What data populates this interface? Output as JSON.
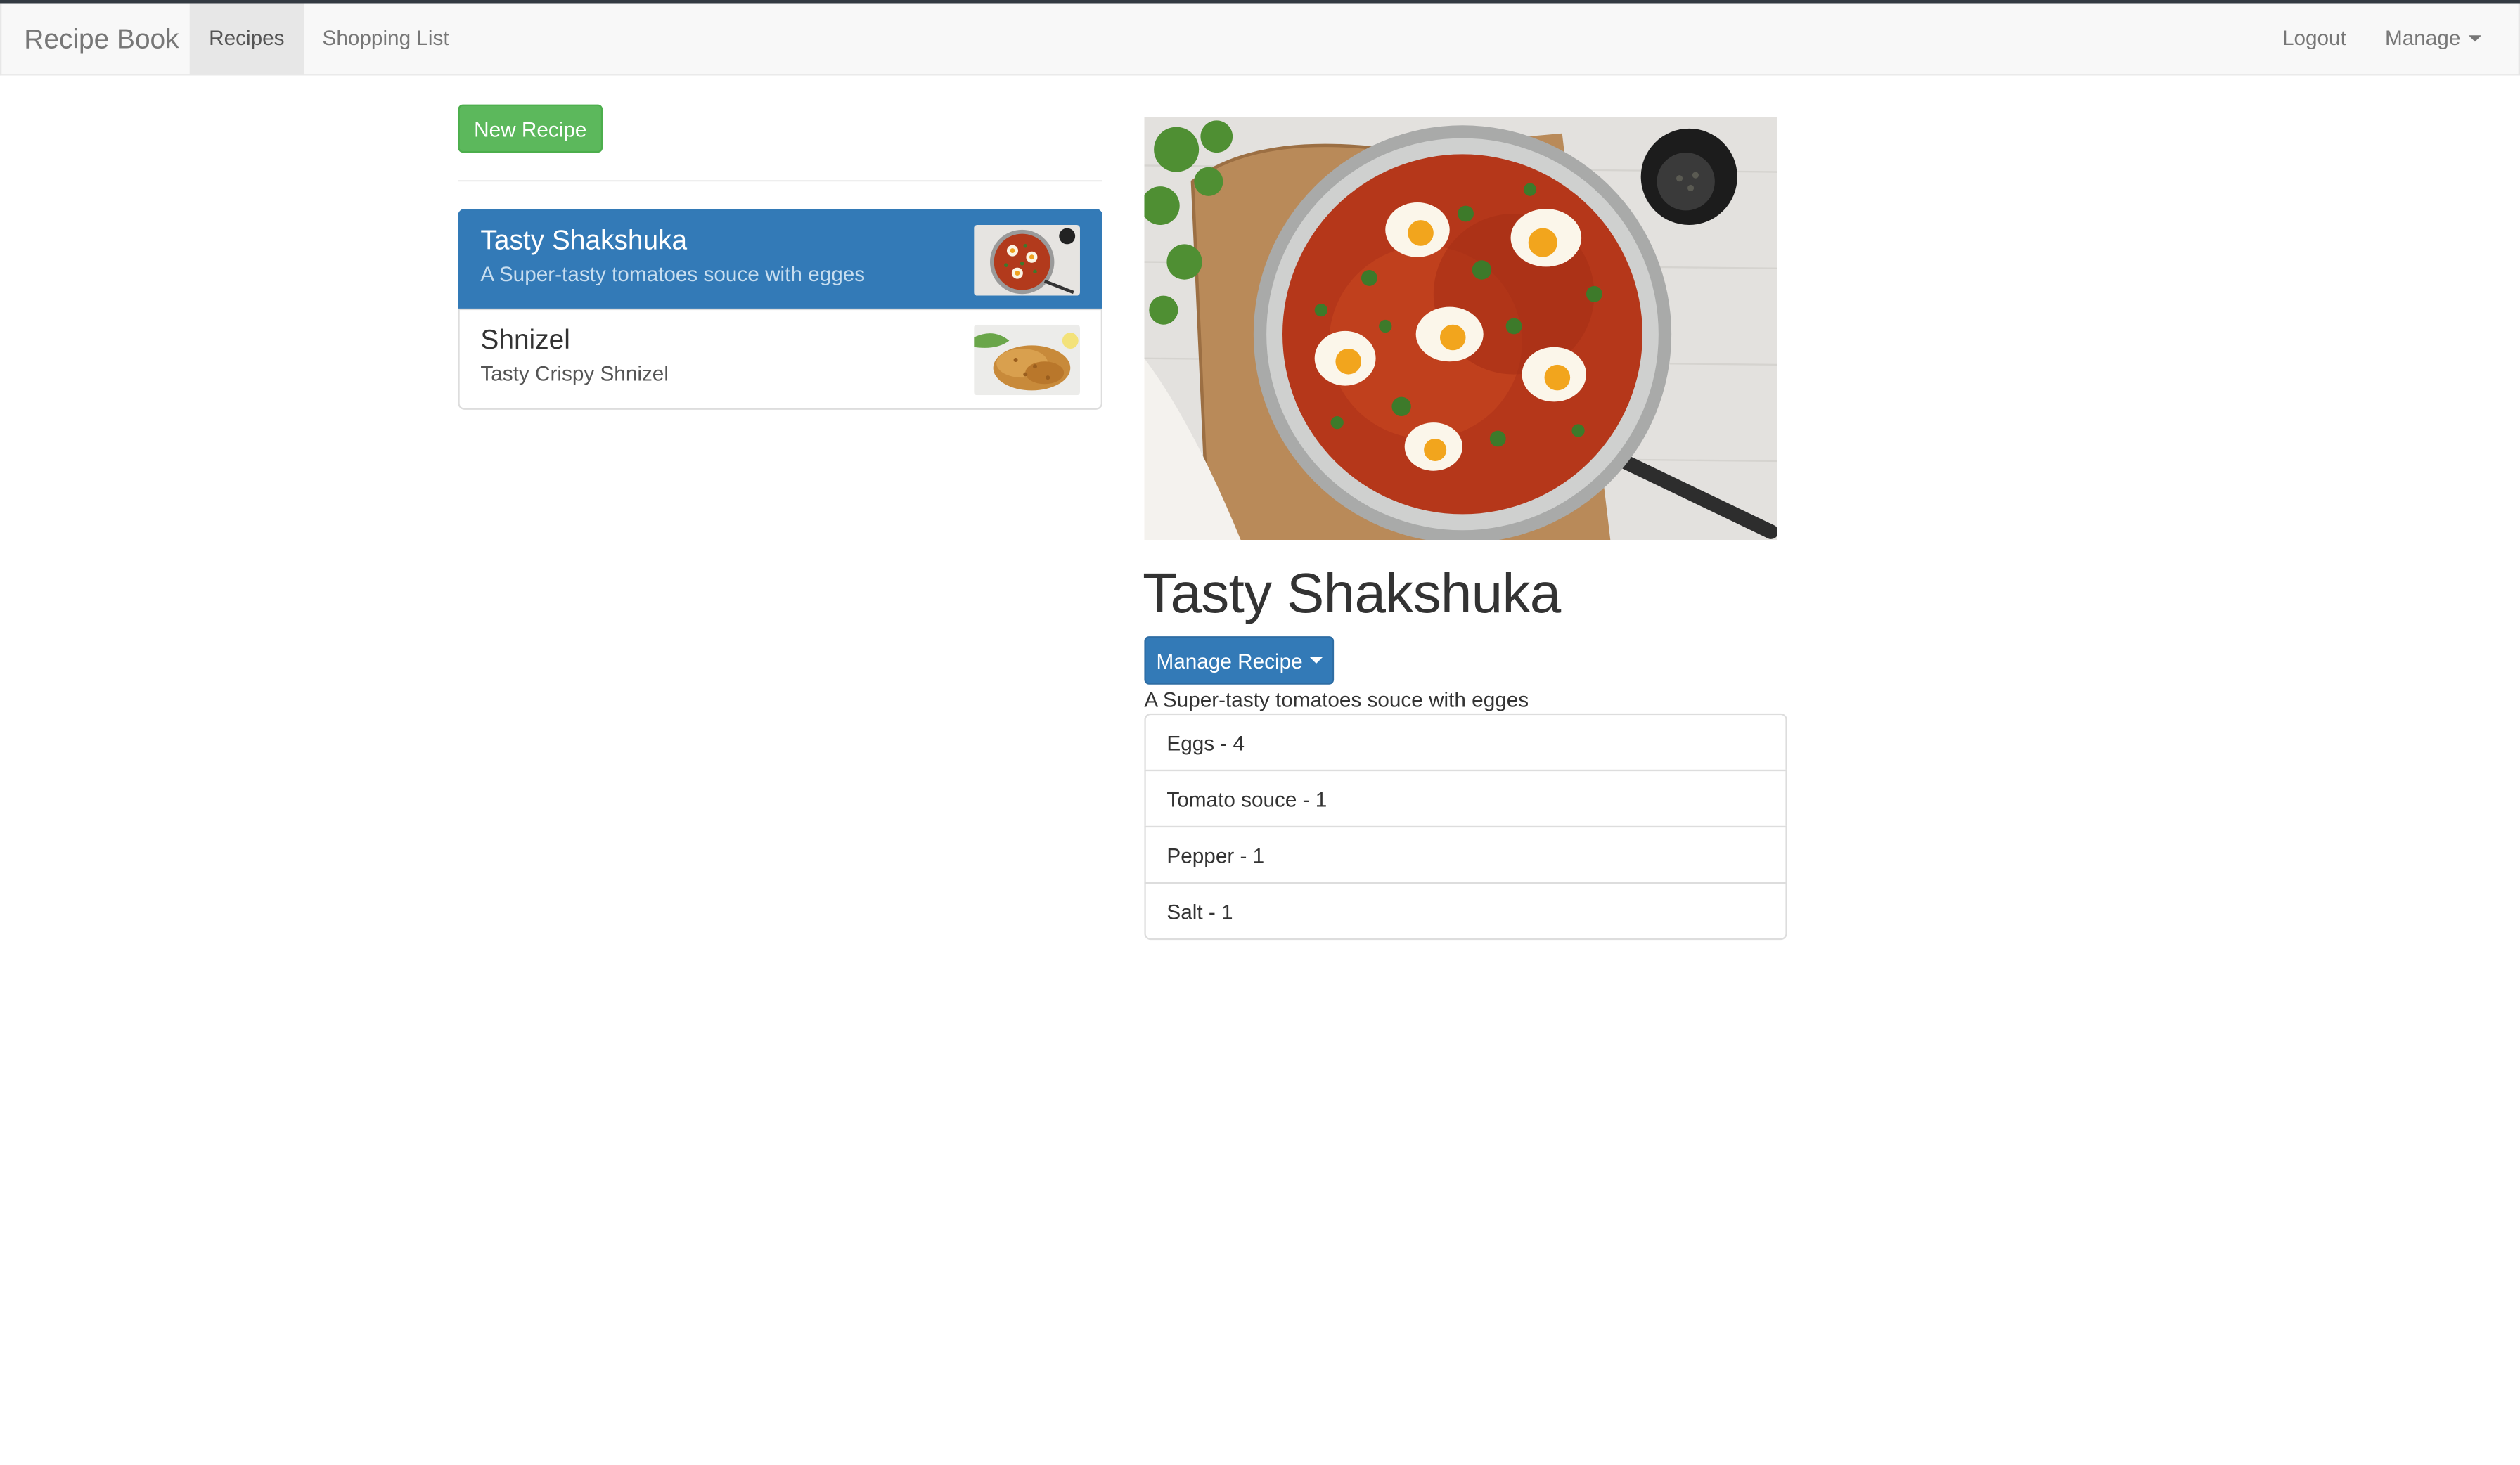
{
  "navbar": {
    "brand": "Recipe Book",
    "items": [
      {
        "label": "Recipes",
        "active": true
      },
      {
        "label": "Shopping List",
        "active": false
      }
    ],
    "logout": "Logout",
    "manage": "Manage"
  },
  "new_recipe_button": "New Recipe",
  "recipes": [
    {
      "name": "Tasty Shakshuka",
      "description": "A Super-tasty tomatoes souce with egges",
      "active": true
    },
    {
      "name": "Shnizel",
      "description": "Tasty Crispy Shnizel",
      "active": false
    }
  ],
  "detail": {
    "title": "Tasty Shakshuka",
    "manage_button": "Manage Recipe",
    "description": "A Super-tasty tomatoes souce with egges",
    "ingredients": [
      "Eggs - 4",
      "Tomato souce - 1",
      "Pepper - 1",
      "Salt - 1"
    ]
  },
  "colors": {
    "primary": "#337ab7",
    "success": "#5cb85c",
    "navbar_bg": "#f8f8f8"
  }
}
